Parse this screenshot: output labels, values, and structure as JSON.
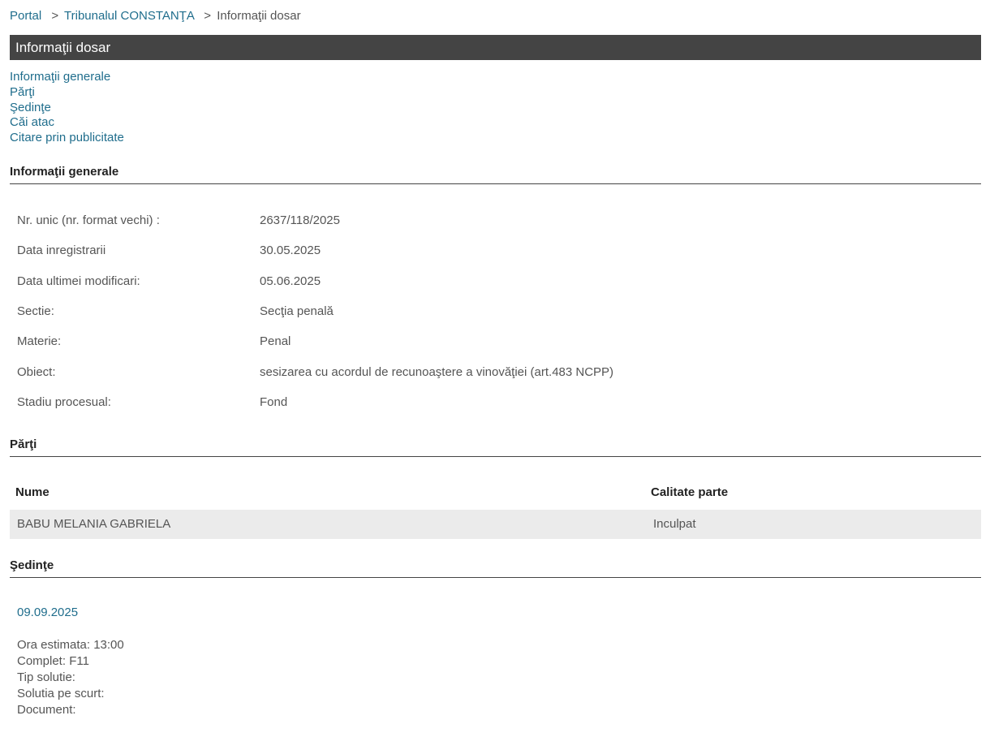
{
  "breadcrumb": {
    "portal": "Portal",
    "court": "Tribunalul CONSTANŢA",
    "current": "Informaţii dosar",
    "separator": ">"
  },
  "title": "Informaţii dosar",
  "quick_nav": [
    "Informaţii generale",
    "Părţi",
    "Şedinţe",
    "Căi atac",
    "Citare prin publicitate"
  ],
  "general": {
    "heading": "Informaţii generale",
    "rows": [
      {
        "label": "Nr. unic (nr. format vechi) :",
        "value": "2637/118/2025"
      },
      {
        "label": "Data inregistrarii",
        "value": "30.05.2025"
      },
      {
        "label": "Data ultimei modificari:",
        "value": "05.06.2025"
      },
      {
        "label": "Sectie:",
        "value": "Secţia penală"
      },
      {
        "label": "Materie:",
        "value": "Penal"
      },
      {
        "label": "Obiect:",
        "value": "sesizarea cu acordul de recunoaştere a vinovăţiei (art.483 NCPP)"
      },
      {
        "label": "Stadiu procesual:",
        "value": "Fond"
      }
    ]
  },
  "parties": {
    "heading": "Părţi",
    "col_name": "Nume",
    "col_role": "Calitate parte",
    "rows": [
      {
        "name": "BABU MELANIA GABRIELA",
        "role": "Inculpat"
      }
    ]
  },
  "hearings": {
    "heading": "Şedinţe",
    "date": "09.09.2025",
    "lines": [
      "Ora estimata: 13:00",
      "Complet: F11",
      "Tip solutie:",
      "Solutia pe scurt:",
      "Document:"
    ]
  },
  "colors": {
    "link": "#1f6d8c",
    "title_bar": "#444444",
    "row_highlight": "#ebebeb"
  }
}
